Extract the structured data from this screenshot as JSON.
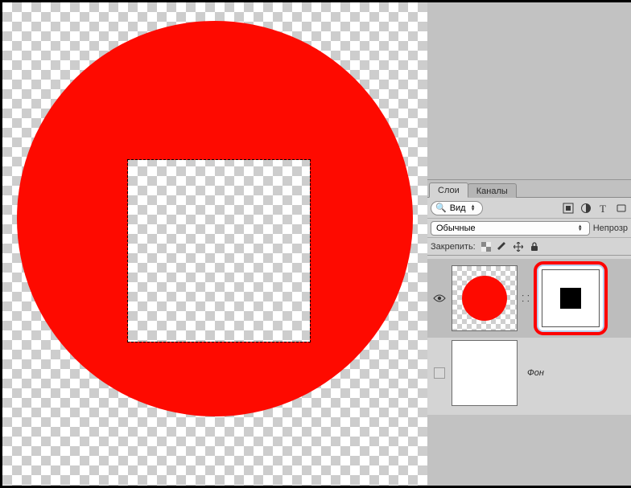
{
  "tabs": {
    "layers": "Слои",
    "channels": "Каналы"
  },
  "search": {
    "label": "Вид"
  },
  "blend": {
    "mode": "Обычные",
    "opacity_label": "Непрозр"
  },
  "lock": {
    "label": "Закрепить:"
  },
  "layers": {
    "background_name": "Фон"
  }
}
